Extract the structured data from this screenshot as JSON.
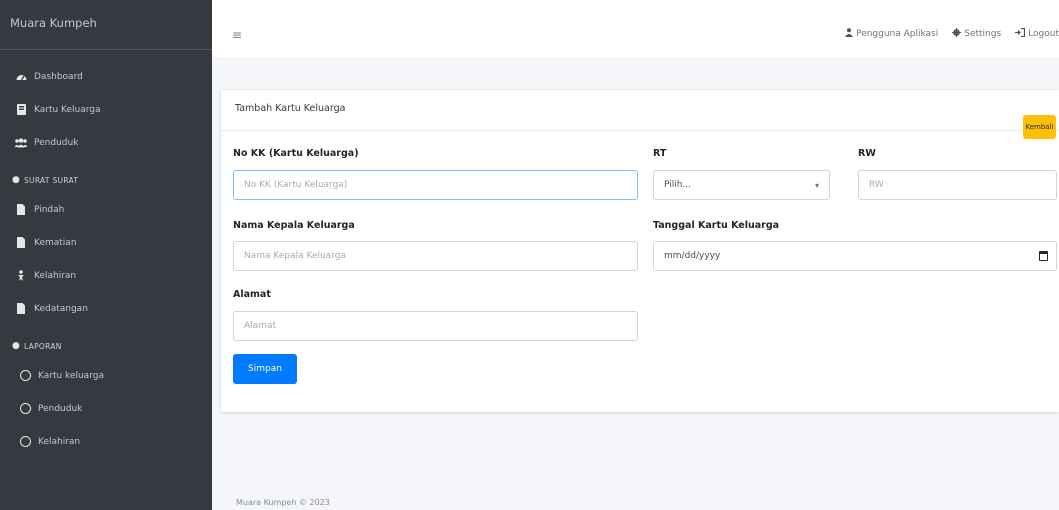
{
  "sidebar": {
    "brand": "Muara Kumpeh",
    "items": [
      {
        "label": "Dashboard",
        "icon": "tachometer-icon"
      },
      {
        "label": "Kartu Keluarga",
        "icon": "book-icon"
      },
      {
        "label": "Penduduk",
        "icon": "users-icon"
      }
    ],
    "section_surat": "SURAT SURAT",
    "surat_items": [
      {
        "label": "Pindah",
        "icon": "file-icon"
      },
      {
        "label": "Kematian",
        "icon": "file-icon"
      },
      {
        "label": "Kelahiran",
        "icon": "baby-icon"
      },
      {
        "label": "Kedatangan",
        "icon": "file-icon"
      }
    ],
    "section_laporan": "LAPORAN",
    "laporan_items": [
      {
        "label": "Kartu keluarga",
        "icon": "circle-icon"
      },
      {
        "label": "Penduduk",
        "icon": "circle-icon"
      },
      {
        "label": "Kelahiran",
        "icon": "circle-icon"
      }
    ]
  },
  "topbar": {
    "menu_icon": "hamburger-icon",
    "user_link": "Pengguna Aplikasi",
    "settings_link": "Settings",
    "logout_link": "Logout"
  },
  "card": {
    "title": "Tambah Kartu Keluarga",
    "back_button": "Kembali"
  },
  "form": {
    "no_kk_label": "No KK (Kartu Keluarga)",
    "no_kk_placeholder": "No KK (Kartu Keluarga)",
    "rt_label": "RT",
    "rt_selected": "Pilih...",
    "rw_label": "RW",
    "rw_placeholder": "RW",
    "nama_label": "Nama Kepala Keluarga",
    "nama_placeholder": "Nama Kepala Keluarga",
    "tanggal_label": "Tanggal Kartu Keluarga",
    "tanggal_placeholder": "mm/dd/yyyy",
    "alamat_label": "Alamat",
    "alamat_placeholder": "Alamat",
    "save_button": "Simpan"
  },
  "footer": {
    "text": "Muara Kumpeh © 2023"
  },
  "colors": {
    "sidebar_bg": "#343a40",
    "primary": "#007bff",
    "warning": "#ffc107"
  }
}
